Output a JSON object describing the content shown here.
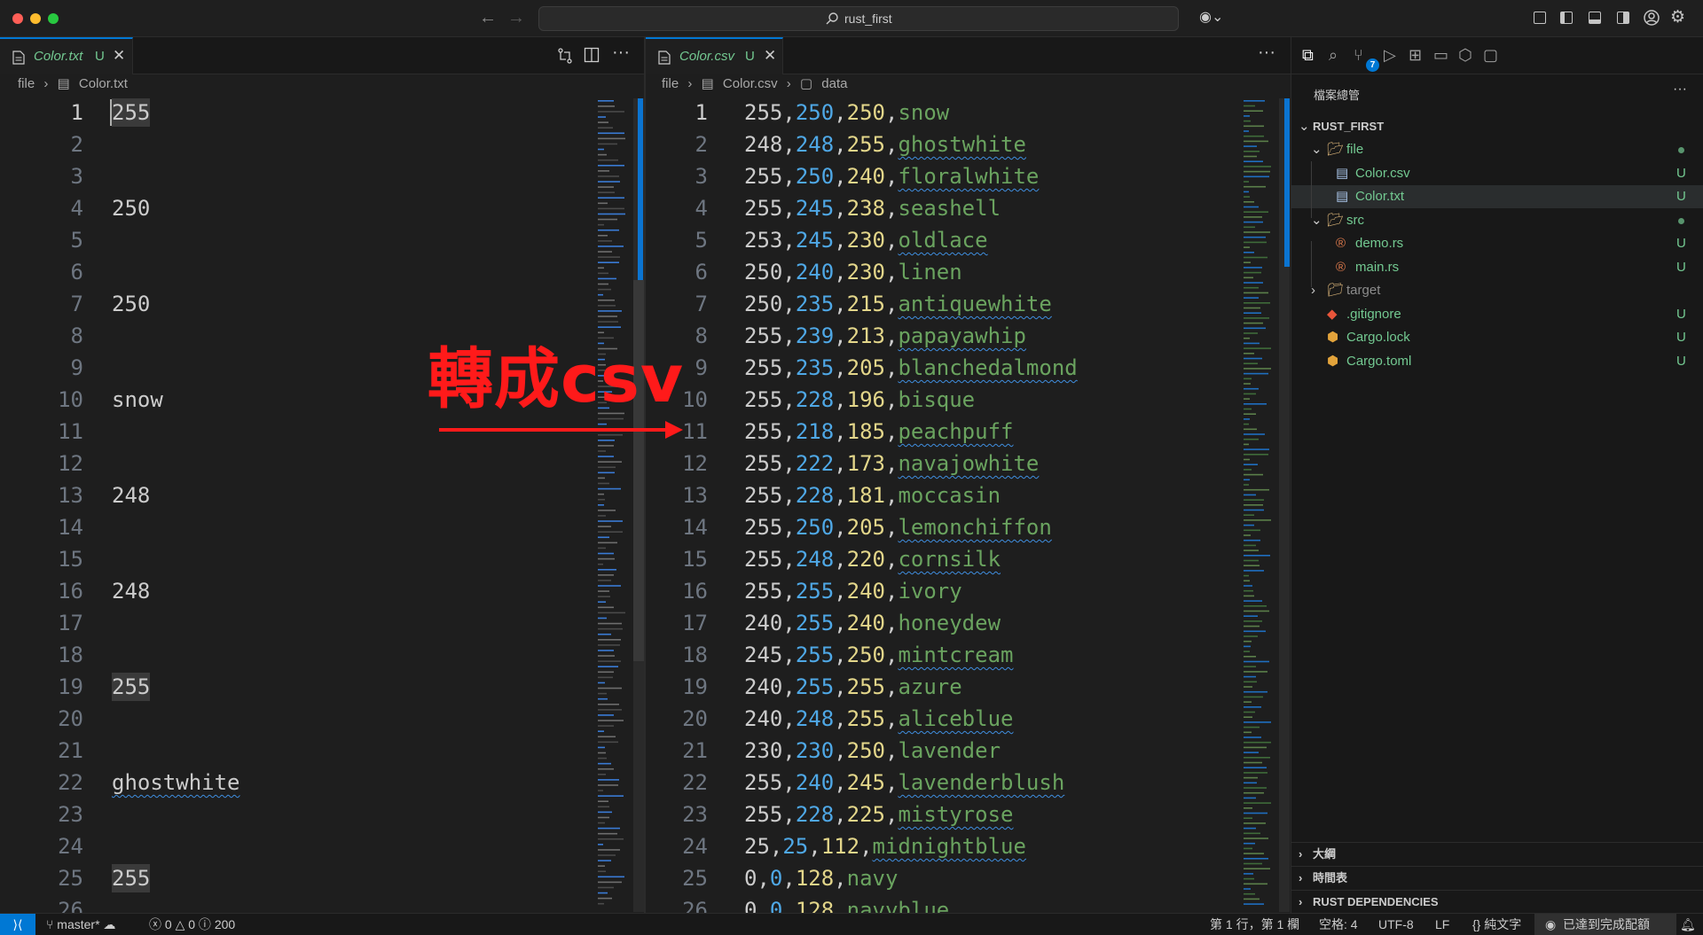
{
  "window": {
    "search_text": "rust_first"
  },
  "left_editor": {
    "tab": {
      "name": "Color.txt",
      "status": "U"
    },
    "breadcrumb": [
      "file",
      "Color.txt"
    ],
    "lines": [
      {
        "n": "1",
        "t": "255",
        "hl": true,
        "cur": true
      },
      {
        "n": "2",
        "t": ""
      },
      {
        "n": "3",
        "t": ""
      },
      {
        "n": "4",
        "t": "250"
      },
      {
        "n": "5",
        "t": ""
      },
      {
        "n": "6",
        "t": ""
      },
      {
        "n": "7",
        "t": "250"
      },
      {
        "n": "8",
        "t": ""
      },
      {
        "n": "9",
        "t": ""
      },
      {
        "n": "10",
        "t": "snow"
      },
      {
        "n": "11",
        "t": ""
      },
      {
        "n": "12",
        "t": ""
      },
      {
        "n": "13",
        "t": "248"
      },
      {
        "n": "14",
        "t": ""
      },
      {
        "n": "15",
        "t": ""
      },
      {
        "n": "16",
        "t": "248"
      },
      {
        "n": "17",
        "t": ""
      },
      {
        "n": "18",
        "t": ""
      },
      {
        "n": "19",
        "t": "255",
        "hl": true
      },
      {
        "n": "20",
        "t": ""
      },
      {
        "n": "21",
        "t": ""
      },
      {
        "n": "22",
        "t": "ghostwhite",
        "squig": true
      },
      {
        "n": "23",
        "t": ""
      },
      {
        "n": "24",
        "t": ""
      },
      {
        "n": "25",
        "t": "255",
        "hl": true
      },
      {
        "n": "26",
        "t": ""
      }
    ]
  },
  "right_editor": {
    "tab": {
      "name": "Color.csv",
      "status": "U"
    },
    "breadcrumb": [
      "file",
      "Color.csv",
      "data"
    ],
    "rows": [
      {
        "n": "1",
        "a": "255",
        "b": "250",
        "c": "250",
        "name": "snow",
        "squig": false
      },
      {
        "n": "2",
        "a": "248",
        "b": "248",
        "c": "255",
        "name": "ghostwhite",
        "squig": true
      },
      {
        "n": "3",
        "a": "255",
        "b": "250",
        "c": "240",
        "name": "floralwhite",
        "squig": true
      },
      {
        "n": "4",
        "a": "255",
        "b": "245",
        "c": "238",
        "name": "seashell",
        "squig": false
      },
      {
        "n": "5",
        "a": "253",
        "b": "245",
        "c": "230",
        "name": "oldlace",
        "squig": true
      },
      {
        "n": "6",
        "a": "250",
        "b": "240",
        "c": "230",
        "name": "linen",
        "squig": false
      },
      {
        "n": "7",
        "a": "250",
        "b": "235",
        "c": "215",
        "name": "antiquewhite",
        "squig": true
      },
      {
        "n": "8",
        "a": "255",
        "b": "239",
        "c": "213",
        "name": "papayawhip",
        "squig": true
      },
      {
        "n": "9",
        "a": "255",
        "b": "235",
        "c": "205",
        "name": "blanchedalmond",
        "squig": true
      },
      {
        "n": "10",
        "a": "255",
        "b": "228",
        "c": "196",
        "name": "bisque",
        "squig": false
      },
      {
        "n": "11",
        "a": "255",
        "b": "218",
        "c": "185",
        "name": "peachpuff",
        "squig": true
      },
      {
        "n": "12",
        "a": "255",
        "b": "222",
        "c": "173",
        "name": "navajowhite",
        "squig": true
      },
      {
        "n": "13",
        "a": "255",
        "b": "228",
        "c": "181",
        "name": "moccasin",
        "squig": false
      },
      {
        "n": "14",
        "a": "255",
        "b": "250",
        "c": "205",
        "name": "lemonchiffon",
        "squig": true
      },
      {
        "n": "15",
        "a": "255",
        "b": "248",
        "c": "220",
        "name": "cornsilk",
        "squig": true
      },
      {
        "n": "16",
        "a": "255",
        "b": "255",
        "c": "240",
        "name": "ivory",
        "squig": false
      },
      {
        "n": "17",
        "a": "240",
        "b": "255",
        "c": "240",
        "name": "honeydew",
        "squig": false
      },
      {
        "n": "18",
        "a": "245",
        "b": "255",
        "c": "250",
        "name": "mintcream",
        "squig": true
      },
      {
        "n": "19",
        "a": "240",
        "b": "255",
        "c": "255",
        "name": "azure",
        "squig": false
      },
      {
        "n": "20",
        "a": "240",
        "b": "248",
        "c": "255",
        "name": "aliceblue",
        "squig": true
      },
      {
        "n": "21",
        "a": "230",
        "b": "230",
        "c": "250",
        "name": "lavender",
        "squig": false
      },
      {
        "n": "22",
        "a": "255",
        "b": "240",
        "c": "245",
        "name": "lavenderblush",
        "squig": true
      },
      {
        "n": "23",
        "a": "255",
        "b": "228",
        "c": "225",
        "name": "mistyrose",
        "squig": true
      },
      {
        "n": "24",
        "a": "25",
        "b": "25",
        "c": "112",
        "name": "midnightblue",
        "squig": true
      },
      {
        "n": "25",
        "a": "0",
        "b": "0",
        "c": "128",
        "name": "navy",
        "squig": false
      },
      {
        "n": "26",
        "a": "0",
        "b": "0",
        "c": "128",
        "name": "navyblue",
        "squig": true
      }
    ]
  },
  "annotation": {
    "text": "轉成csv"
  },
  "explorer": {
    "title": "檔案總管",
    "project": "RUST_FIRST",
    "items": [
      {
        "label": "file",
        "icon": "folder-open-icon",
        "status": "dot",
        "indent": 1,
        "twisty": "open"
      },
      {
        "label": "Color.csv",
        "icon": "file-lines-icon",
        "status": "U",
        "indent": 2
      },
      {
        "label": "Color.txt",
        "icon": "file-lines-icon",
        "status": "U",
        "indent": 2,
        "selected": true
      },
      {
        "label": "src",
        "icon": "folder-open-icon",
        "status": "dot",
        "indent": 1,
        "twisty": "open"
      },
      {
        "label": "demo.rs",
        "icon": "rust-file-icon",
        "status": "U",
        "indent": 2
      },
      {
        "label": "main.rs",
        "icon": "rust-file-icon",
        "status": "U",
        "indent": 2
      },
      {
        "label": "target",
        "icon": "folder-icon",
        "status": "",
        "indent": 1,
        "twisty": "closed"
      },
      {
        "label": ".gitignore",
        "icon": "git-icon",
        "status": "U",
        "indent": 1
      },
      {
        "label": "Cargo.lock",
        "icon": "package-icon",
        "status": "U",
        "indent": 1
      },
      {
        "label": "Cargo.toml",
        "icon": "package-icon",
        "status": "U",
        "indent": 1
      }
    ],
    "sections": [
      "大綱",
      "時間表",
      "RUST DEPENDENCIES"
    ],
    "badge": "7"
  },
  "statusbar": {
    "branch": "master*",
    "errors": "0",
    "warnings": "0",
    "info": "200",
    "position": "第 1 行，第 1 欄",
    "spaces": "空格: 4",
    "encoding": "UTF-8",
    "eol": "LF",
    "language": "純文字",
    "copilot": "已達到完成配額"
  },
  "colors": {
    "accent": "#0078d4",
    "untracked": "#73c991",
    "annotation": "#ff1a1a"
  }
}
